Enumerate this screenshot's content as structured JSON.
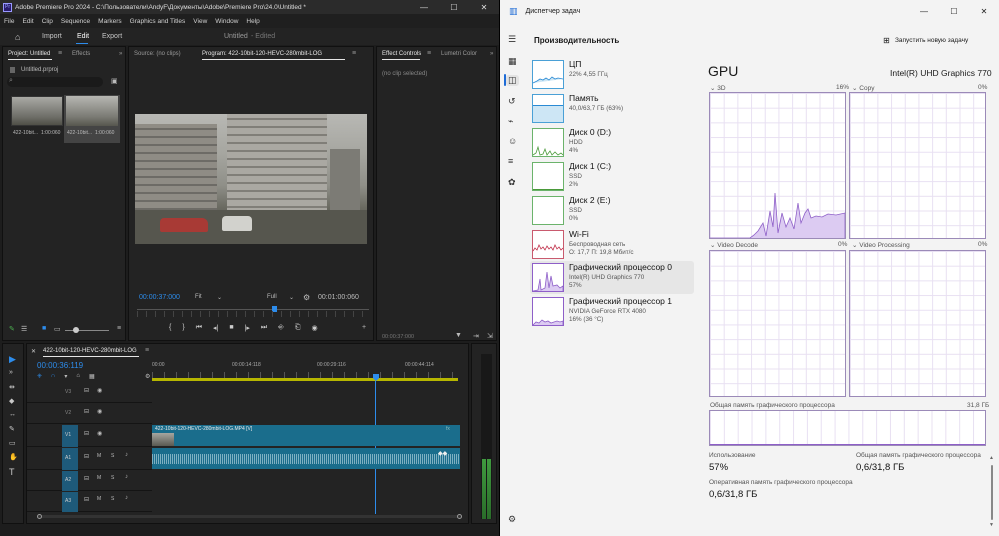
{
  "premiere": {
    "title": "Adobe Premiere Pro 2024 - C:\\Пользователи\\AndyF\\Документы\\Adobe\\Premiere Pro\\24.0\\Untitled *",
    "menu": [
      "File",
      "Edit",
      "Clip",
      "Sequence",
      "Markers",
      "Graphics and Titles",
      "View",
      "Window",
      "Help"
    ],
    "header": {
      "import": "Import",
      "edit": "Edit",
      "export": "Export",
      "project_name": "Untitled",
      "status": "- Edited"
    },
    "project": {
      "tab": "Project: Untitled",
      "tab2": "Effects",
      "file": "Untitled.prproj",
      "clips": [
        {
          "name": "422-10bit...",
          "duration": "1:00:060"
        },
        {
          "name": "422-10bit...",
          "duration": "1:00:060"
        }
      ]
    },
    "source_tab": "Source: (no clips)",
    "program": {
      "tab": "Program: 422-10bit-120-HEVC-280mbit-LOG",
      "timecode": "00:00:37:000",
      "fit": "Fit",
      "quality": "Full",
      "duration": "00:01:00:060"
    },
    "effect_controls": {
      "tab": "Effect Controls",
      "tab2": "Lumetri Color",
      "no_clip": "(no clip selected)",
      "time": "00:00:37:000"
    },
    "timeline": {
      "sequence": "422-10bit-120-HEVC-280mbit-LOG",
      "timecode": "00:00:36:119",
      "ruler": [
        "00:00",
        "00:00:14:118",
        "00:00:29:116",
        "00:00:44:114"
      ],
      "tracks_v": [
        "V3",
        "V2",
        "V1"
      ],
      "tracks_a": [
        "A1",
        "A2",
        "A3"
      ],
      "clip_label": "422-10bit-120-HEVC-280mbit-LOG.MP4 [V]"
    }
  },
  "taskmanager": {
    "title": "Диспетчер задач",
    "section": "Производительность",
    "new_task": "Запустить новую задачу",
    "categories": [
      {
        "name": "ЦП",
        "sub1": "22% 4,55 ГГц",
        "sub2": ""
      },
      {
        "name": "Память",
        "sub1": "40,0/63,7 ГБ (63%)",
        "sub2": ""
      },
      {
        "name": "Диск 0 (D:)",
        "sub1": "HDD",
        "sub2": "4%"
      },
      {
        "name": "Диск 1 (C:)",
        "sub1": "SSD",
        "sub2": "2%"
      },
      {
        "name": "Диск 2 (E:)",
        "sub1": "SSD",
        "sub2": "0%"
      },
      {
        "name": "Wi-Fi",
        "sub1": "Беспроводная сеть",
        "sub2": "О: 17,7 П: 19,8 Мбит/с"
      },
      {
        "name": "Графический процессор 0",
        "sub1": "Intel(R) UHD Graphics 770",
        "sub2": "57%"
      },
      {
        "name": "Графический процессор 1",
        "sub1": "NVIDIA GeForce RTX 4080",
        "sub2": "16% (36 °C)"
      }
    ],
    "gpu": {
      "heading": "GPU",
      "model": "Intel(R) UHD Graphics 770",
      "engines": [
        {
          "name": "3D",
          "pct": "16%"
        },
        {
          "name": "Copy",
          "pct": "0%"
        },
        {
          "name": "Video Decode",
          "pct": "0%"
        },
        {
          "name": "Video Processing",
          "pct": "0%"
        }
      ],
      "shared_label": "Общая память графического процессора",
      "shared_max": "31,8 ГБ",
      "usage_label": "Использование",
      "usage": "57%",
      "shared_mem_label": "Общая память графического процессора",
      "shared_mem": "0,6/31,8 ГБ",
      "ram_label": "Оперативная память графического процессора",
      "ram": "0,6/31,8 ГБ"
    },
    "accent": "#8e5fc8"
  }
}
